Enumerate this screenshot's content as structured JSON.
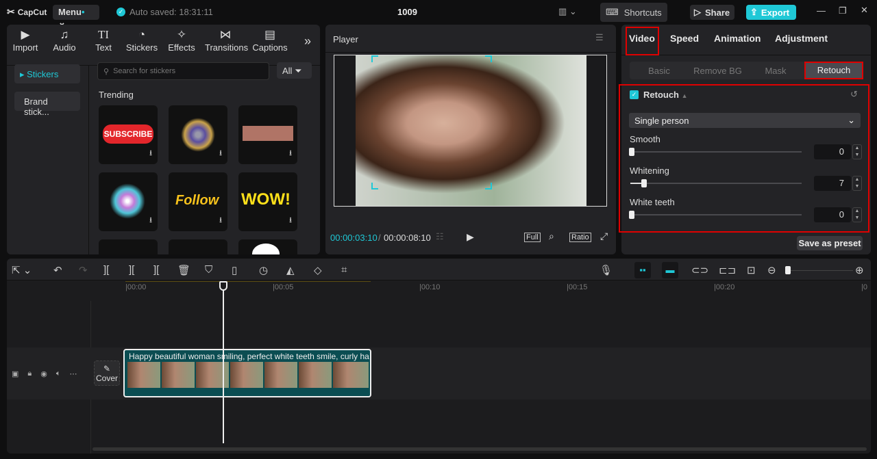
{
  "app": {
    "logo": "CapCut",
    "menu": "Menu",
    "autosave": "Auto saved: 18:31:11",
    "title": "1009",
    "shortcuts": "Shortcuts",
    "share": "Share",
    "export": "Export"
  },
  "media_tabs": [
    {
      "label": "Import",
      "icon": "▶"
    },
    {
      "label": "Audio",
      "icon": "♫"
    },
    {
      "label": "Text",
      "icon": "TI"
    },
    {
      "label": "Stickers",
      "icon": "◔"
    },
    {
      "label": "Effects",
      "icon": "✧"
    },
    {
      "label": "Transitions",
      "icon": "⋈"
    },
    {
      "label": "Captions",
      "icon": "▤"
    }
  ],
  "sticker_nav": {
    "active": "Stickers",
    "brand": "Brand stick..."
  },
  "search": {
    "placeholder": "Search for stickers",
    "filter": "All"
  },
  "section": "Trending",
  "stickers": [
    {
      "label": "SUBSCRIBE"
    },
    {
      "label": "firework"
    },
    {
      "label": "tape"
    },
    {
      "label": "burst"
    },
    {
      "label": "Follow"
    },
    {
      "label": "WOW!"
    }
  ],
  "player": {
    "title": "Player",
    "current": "00:00:03:10",
    "total": "00:00:08:10",
    "full": "Full",
    "ratio": "Ratio"
  },
  "right": {
    "tabs": [
      "Video",
      "Speed",
      "Animation",
      "Adjustment"
    ],
    "subtabs": [
      "Basic",
      "Remove BG",
      "Mask",
      "Retouch"
    ],
    "section": "Retouch",
    "mode": "Single person",
    "sliders": [
      {
        "label": "Smooth",
        "value": "0",
        "fraction": 0
      },
      {
        "label": "Whitening",
        "value": "7",
        "fraction": 0.07
      },
      {
        "label": "White teeth",
        "value": "0",
        "fraction": 0
      }
    ],
    "save_preset": "Save as preset"
  },
  "timeline": {
    "ticks": [
      "00:00",
      "00:05",
      "00:10",
      "00:15",
      "00:20",
      "0"
    ],
    "cover": "Cover",
    "clip_title": "Happy beautiful woman smiling, perfect white teeth smile, curly ha"
  },
  "colors": {
    "accent": "#1fc8d6",
    "highlight": "#e00000",
    "clip": "#0b4d52"
  }
}
